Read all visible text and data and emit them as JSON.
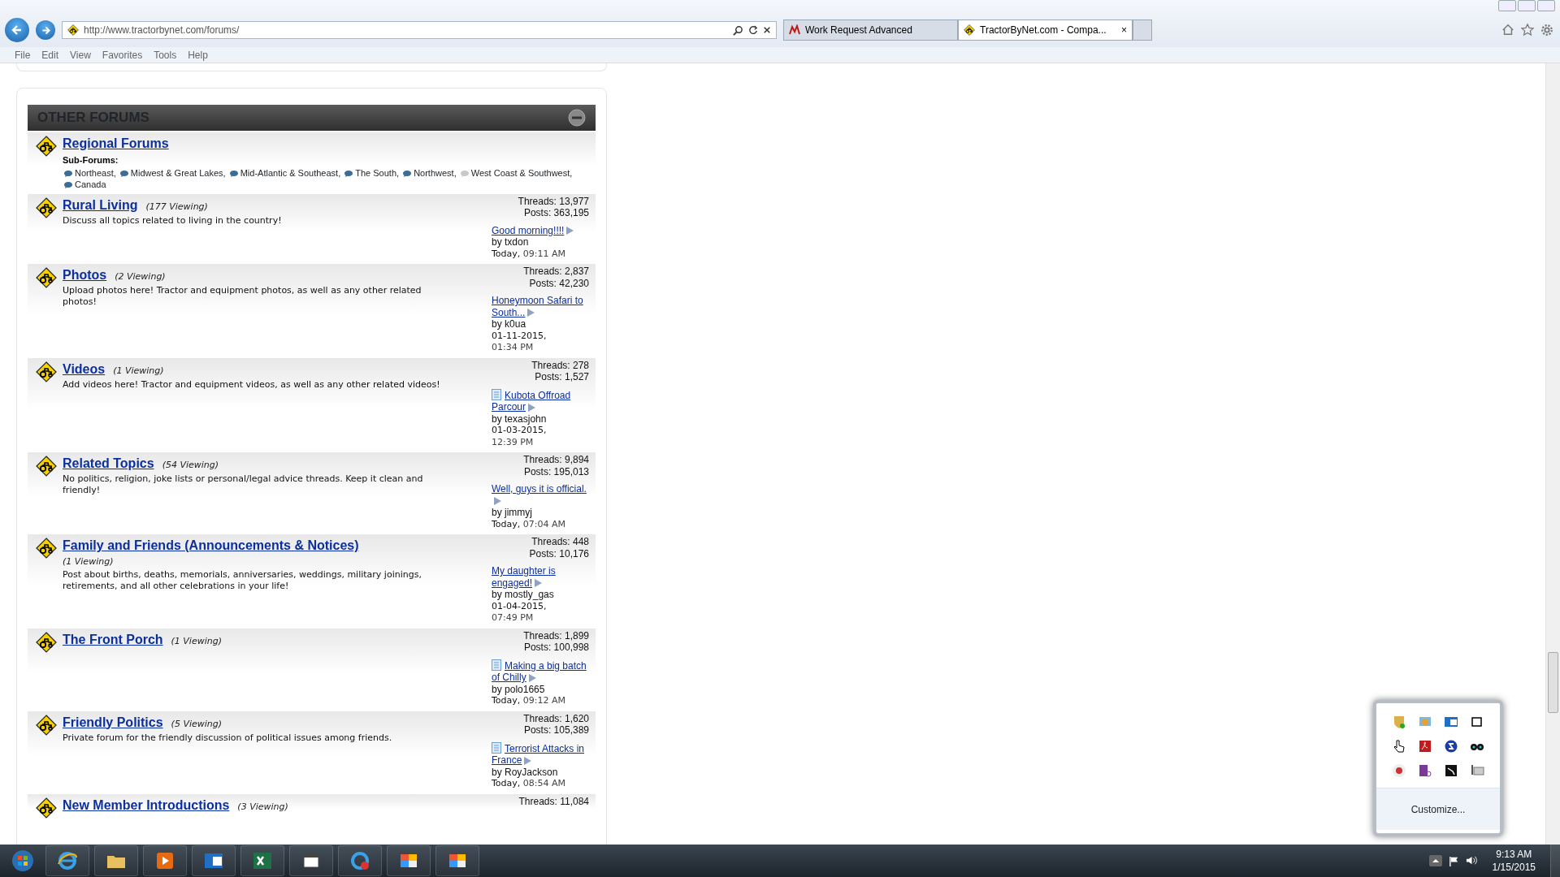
{
  "browser": {
    "address": "http://www.tractorbynet.com/forums/",
    "tabs": [
      {
        "title": "Work Request Advanced",
        "selected": false,
        "kind": "work"
      },
      {
        "title": "TractorByNet.com - Compa...",
        "selected": true,
        "kind": "site"
      }
    ],
    "tab_close": "×",
    "menu": [
      "File",
      "Edit",
      "View",
      "Favorites",
      "Tools",
      "Help"
    ]
  },
  "forum_panel": {
    "title": "OTHER FORUMS",
    "subforums_label": "Sub-Forums:",
    "forums": [
      {
        "name": "Regional Forums",
        "subforums": [
          {
            "name": "Northeast",
            "new": true,
            "sep": ","
          },
          {
            "name": "Midwest & Great Lakes",
            "new": true,
            "sep": ","
          },
          {
            "name": "Mid-Atlantic & Southeast",
            "new": true,
            "sep": ","
          },
          {
            "name": "The South",
            "new": true,
            "sep": ","
          },
          {
            "name": "Northwest",
            "new": true,
            "sep": ","
          },
          {
            "name": "West Coast & Southwest",
            "new": false,
            "sep": ","
          },
          {
            "name": "Canada",
            "new": true
          }
        ]
      },
      {
        "name": "Rural Living",
        "viewing": "(177 Viewing)",
        "description": "Discuss all topics related to living in the country!",
        "threads": "Threads: 13,977",
        "posts": "Posts: 363,195",
        "last_post": {
          "title": "Good morning!!!!",
          "doc_icon": false,
          "by": "by",
          "author": "txdon",
          "date": "Today,",
          "time": "09:11 AM"
        }
      },
      {
        "name": "Photos",
        "viewing": "(2 Viewing)",
        "description": "Upload photos here! Tractor and equipment photos, as well as any other related photos!",
        "threads": "Threads: 2,837",
        "posts": "Posts: 42,230",
        "last_post": {
          "title": "Honeymoon Safari to South...",
          "doc_icon": false,
          "by": "by",
          "author": "k0ua",
          "date": "01-11-2015,",
          "time": "01:34 PM"
        }
      },
      {
        "name": "Videos",
        "viewing": "(1 Viewing)",
        "description": "Add videos here! Tractor and equipment videos, as well as any other related videos!",
        "threads": "Threads: 278",
        "posts": "Posts: 1,527",
        "last_post": {
          "title": "Kubota Offroad Parcour",
          "doc_icon": true,
          "by": "by",
          "author": "texasjohn",
          "date": "01-03-2015,",
          "time": "12:39 PM"
        }
      },
      {
        "name": "Related Topics",
        "viewing": "(54 Viewing)",
        "description": "No politics, religion, joke lists or personal/legal advice threads. Keep it clean and friendly!",
        "threads": "Threads: 9,894",
        "posts": "Posts: 195,013",
        "last_post": {
          "title": "Well, guys it is official.",
          "doc_icon": false,
          "by": "by",
          "author": "jimmyj",
          "date": "Today,",
          "time": "07:04 AM"
        }
      },
      {
        "name": "Family and Friends (Announcements & Notices)",
        "viewing": "(1 Viewing)",
        "viewing_below": true,
        "description": "Post about births, deaths, memorials, anniversaries, weddings, military joinings, retirements, and all other celebrations in your life!",
        "threads": "Threads: 448",
        "posts": "Posts: 10,176",
        "last_post": {
          "title": "My daughter is engaged!",
          "doc_icon": false,
          "by": "by",
          "author": "mostly_gas",
          "date": "01-04-2015,",
          "time": "07:49 PM"
        }
      },
      {
        "name": "The Front Porch",
        "viewing": "(1 Viewing)",
        "threads": "Threads: 1,899",
        "posts": "Posts: 100,998",
        "last_post": {
          "title": "Making a big batch of Chilly",
          "doc_icon": true,
          "by": "by",
          "author": "polo1665",
          "date": "Today,",
          "time": "09:12 AM"
        }
      },
      {
        "name": "Friendly Politics",
        "viewing": "(5 Viewing)",
        "description": "Private forum for the friendly discussion of political issues among friends.",
        "threads": "Threads: 1,620",
        "posts": "Posts: 105,389",
        "last_post": {
          "title": "Terrorist Attacks in France",
          "doc_icon": true,
          "by": "by",
          "author": "RoyJackson",
          "date": "Today,",
          "time": "08:54 AM"
        }
      },
      {
        "name": "New Member Introductions",
        "viewing": "(3 Viewing)",
        "threads": "Threads: 11,084"
      }
    ]
  },
  "tray_popup": {
    "customize": "Customize..."
  },
  "taskbar": {
    "time": "9:13 AM",
    "date": "1/15/2015"
  }
}
